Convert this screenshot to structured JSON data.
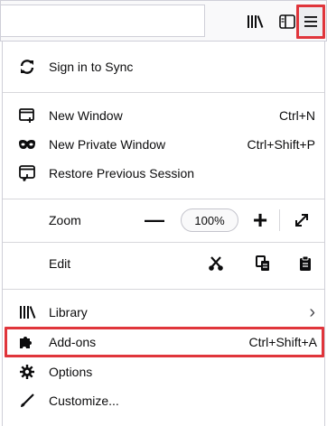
{
  "toolbar": {
    "library_icon": "library-icon",
    "sidebar_icon": "sidebars-icon",
    "menu_icon": "hamburger-menu-icon",
    "highlight_color": "#e0353b"
  },
  "menu": {
    "sync": {
      "label": "Sign in to Sync",
      "icon": "sync-icon"
    },
    "new_window": {
      "label": "New Window",
      "shortcut": "Ctrl+N",
      "icon": "new-window-icon"
    },
    "private_window": {
      "label": "New Private Window",
      "shortcut": "Ctrl+Shift+P",
      "icon": "private-mask-icon"
    },
    "restore": {
      "label": "Restore Previous Session",
      "icon": "restore-session-icon"
    },
    "zoom": {
      "label": "Zoom",
      "minus": "—",
      "value": "100%",
      "plus": "+",
      "fullscreen_icon": "fullscreen-icon"
    },
    "edit": {
      "label": "Edit",
      "cut_icon": "cut-icon",
      "copy_icon": "copy-icon",
      "paste_icon": "paste-icon"
    },
    "library": {
      "label": "Library",
      "icon": "library-icon",
      "arrow": "›"
    },
    "addons": {
      "label": "Add-ons",
      "shortcut": "Ctrl+Shift+A",
      "icon": "puzzle-icon",
      "highlighted": true
    },
    "options": {
      "label": "Options",
      "icon": "gear-icon"
    },
    "customize": {
      "label": "Customize...",
      "icon": "paintbrush-icon"
    }
  }
}
